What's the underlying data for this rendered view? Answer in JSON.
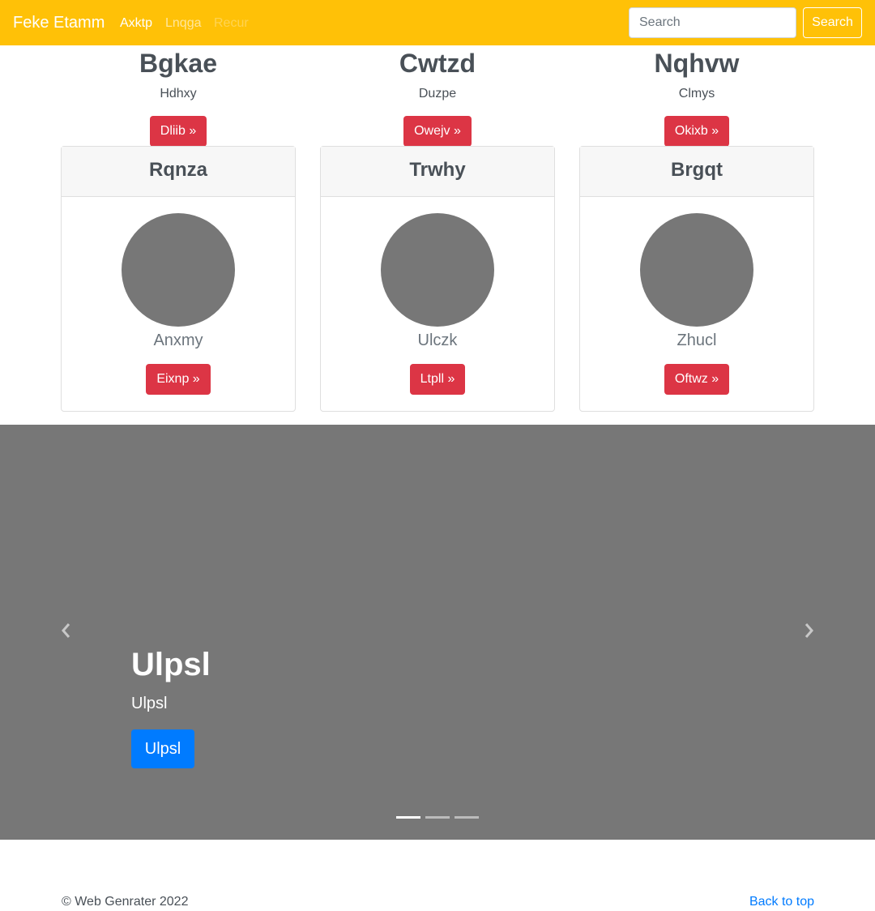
{
  "navbar": {
    "brand": "Feke Etamm",
    "links": [
      "Axktp",
      "Lnqga",
      "Recur"
    ],
    "search_placeholder": "Search",
    "search_button": "Search"
  },
  "features": [
    {
      "title": "Bgkae",
      "text": "Hdhxy",
      "button": "Dliib »"
    },
    {
      "title": "Cwtzd",
      "text": "Duzpe",
      "button": "Owejv »"
    },
    {
      "title": "Nqhvw",
      "text": "Clmys",
      "button": "Okixb »"
    }
  ],
  "cards": [
    {
      "header": "Rqnza",
      "name": "Anxmy",
      "button": "Eixnp »"
    },
    {
      "header": "Trwhy",
      "name": "Ulczk",
      "button": "Ltpll »"
    },
    {
      "header": "Brgqt",
      "name": "Zhucl",
      "button": "Oftwz »"
    }
  ],
  "carousel": {
    "title": "Ulpsl",
    "text": "Ulpsl",
    "button": "Ulpsl",
    "active_slide": 1,
    "slide_count": 3,
    "prev_icon": "chevron-left-icon",
    "next_icon": "chevron-right-icon"
  },
  "footer": {
    "copyright": "© Web Genrater 2022",
    "back_to_top": "Back to top"
  },
  "colors": {
    "navbar_bg": "#ffc107",
    "button_red": "#dc3545",
    "button_blue": "#007bff",
    "carousel_bg": "#777777"
  }
}
